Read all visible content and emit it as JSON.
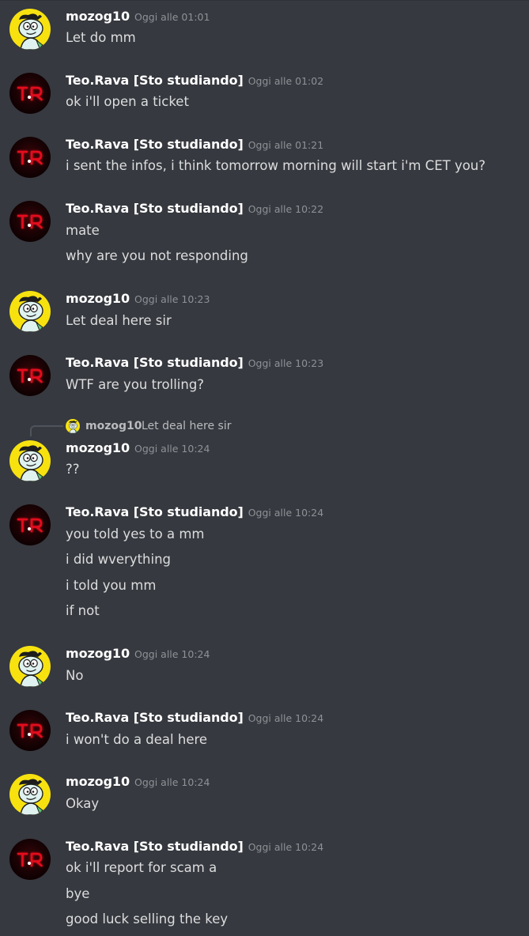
{
  "messages": [
    {
      "author": "mozog10",
      "avatar": "yellow-cartoon-avatar-icon",
      "timestamp": "Oggi alle 01:01",
      "lines": [
        "Let do mm"
      ]
    },
    {
      "author": "Teo.Rava [Sto studiando]",
      "avatar": "tr-logo-avatar-icon",
      "timestamp": "Oggi alle 01:02",
      "lines": [
        "ok i'll open a ticket"
      ]
    },
    {
      "author": "Teo.Rava [Sto studiando]",
      "avatar": "tr-logo-avatar-icon",
      "timestamp": "Oggi alle 01:21",
      "lines": [
        "i sent the infos, i think tomorrow morning will start i'm CET you?"
      ]
    },
    {
      "author": "Teo.Rava [Sto studiando]",
      "avatar": "tr-logo-avatar-icon",
      "timestamp": "Oggi alle 10:22",
      "lines": [
        "mate",
        "why are you not responding"
      ]
    },
    {
      "author": "mozog10",
      "avatar": "yellow-cartoon-avatar-icon",
      "timestamp": "Oggi alle 10:23",
      "lines": [
        "Let deal here sir"
      ]
    },
    {
      "author": "Teo.Rava [Sto studiando]",
      "avatar": "tr-logo-avatar-icon",
      "timestamp": "Oggi alle 10:23",
      "lines": [
        "WTF are you trolling?"
      ]
    },
    {
      "author": "mozog10",
      "avatar": "yellow-cartoon-avatar-icon",
      "timestamp": "Oggi alle 10:24",
      "lines": [
        "??"
      ],
      "reply": {
        "author": "mozog10",
        "text": "Let deal here sir"
      }
    },
    {
      "author": "Teo.Rava [Sto studiando]",
      "avatar": "tr-logo-avatar-icon",
      "timestamp": "Oggi alle 10:24",
      "lines": [
        "you told yes to a mm",
        "i did wverything",
        "i told you mm",
        "if not"
      ]
    },
    {
      "author": "mozog10",
      "avatar": "yellow-cartoon-avatar-icon",
      "timestamp": "Oggi alle 10:24",
      "lines": [
        "No"
      ]
    },
    {
      "author": "Teo.Rava [Sto studiando]",
      "avatar": "tr-logo-avatar-icon",
      "timestamp": "Oggi alle 10:24",
      "lines": [
        "i won't do a deal here"
      ]
    },
    {
      "author": "mozog10",
      "avatar": "yellow-cartoon-avatar-icon",
      "timestamp": "Oggi alle 10:24",
      "lines": [
        "Okay"
      ]
    },
    {
      "author": "Teo.Rava [Sto studiando]",
      "avatar": "tr-logo-avatar-icon",
      "timestamp": "Oggi alle 10:24",
      "lines": [
        "ok i'll report for scam a",
        "bye",
        "good luck selling the key"
      ]
    }
  ],
  "colors": {
    "background": "#36393f",
    "author": "#ffffff",
    "timestamp": "#8e9297",
    "text": "#dcddde",
    "tr_avatar_red": "#e3101e",
    "mozog_avatar_yellow": "#f7e210"
  }
}
